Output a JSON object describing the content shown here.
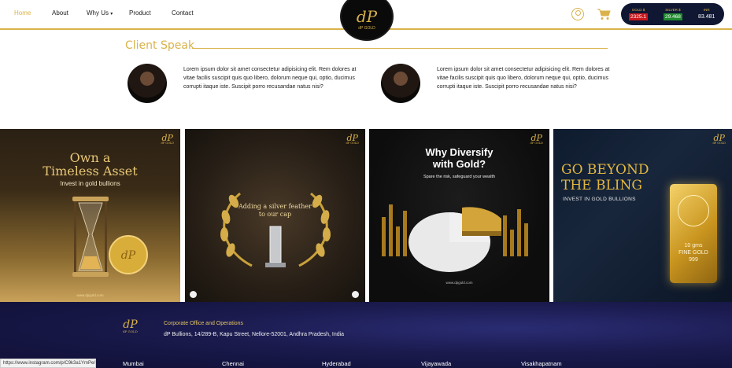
{
  "nav": {
    "home": "Home",
    "about": "About",
    "why_us": "Why Us",
    "product": "Product",
    "contact": "Contact"
  },
  "logo": {
    "mark": "dP",
    "text": "dP GOLD"
  },
  "ticker": {
    "gold_label": "GOLD $",
    "gold_value": "2325.1",
    "silver_label": "SILVER $",
    "silver_value": "29.468",
    "inr_label": "INR",
    "inr_value": "83.481"
  },
  "client_speak": {
    "title": "Client Speak",
    "testimonials": [
      {
        "text": "Lorem ipsum dolor sit amet consectetur adipisicing elit. Rem dolores at vitae facilis suscipit quis quo libero, dolorum neque qui, optio, ducimus corrupti itaque iste. Suscipit porro recusandae natus nisi?"
      },
      {
        "text": "Lorem ipsum dolor sit amet consectetur adipisicing elit. Rem dolores at vitae facilis suscipit quis quo libero, dolorum neque qui, optio, ducimus corrupti itaque iste. Suscipit porro recusandae natus nisi?"
      }
    ]
  },
  "tiles": {
    "badge_mark": "dP",
    "badge_text": "dP GOLD",
    "tile1": {
      "title_line1": "Own a",
      "title_line2": "Timeless Asset",
      "subtitle": "Invest in gold bullions",
      "url": "www.dpgold.com"
    },
    "tile2": {
      "title_line1": "Adding a silver feather",
      "title_line2": "to our cap"
    },
    "tile3": {
      "title_line1": "Why Diversify",
      "title_line2": "with Gold?",
      "subtitle": "Spare the risk, safeguard your wealth",
      "url": "www.dpgold.com"
    },
    "tile4": {
      "title_line1": "GO BEYOND",
      "title_line2": "THE BLING",
      "subtitle": "INVEST IN GOLD BULLIONS",
      "bar_line1": "10 gms",
      "bar_line2": "FINE GOLD",
      "bar_line3": "999"
    }
  },
  "footer": {
    "logo_mark": "dP",
    "logo_text": "dP GOLD",
    "office_title": "Corporate Office and Operations",
    "address": "dP Bullions, 14/289-B, Kapu Street, Nellore-52001, Andhra Pradesh, India",
    "cities": [
      "Mumbai",
      "Chennai",
      "Hyderabad",
      "Vijayawada",
      "Visakhapatnam"
    ]
  },
  "status_bar": {
    "url": "https://www.instagram.com/p/C9k3a1YmPe/"
  },
  "colors": {
    "accent_gold": "#d9b24a",
    "ticker_bg": "#0f1733",
    "gold_price_bg": "#c8171d",
    "silver_price_bg": "#1f8a2e",
    "footer_bg": "#1a1a4d"
  }
}
